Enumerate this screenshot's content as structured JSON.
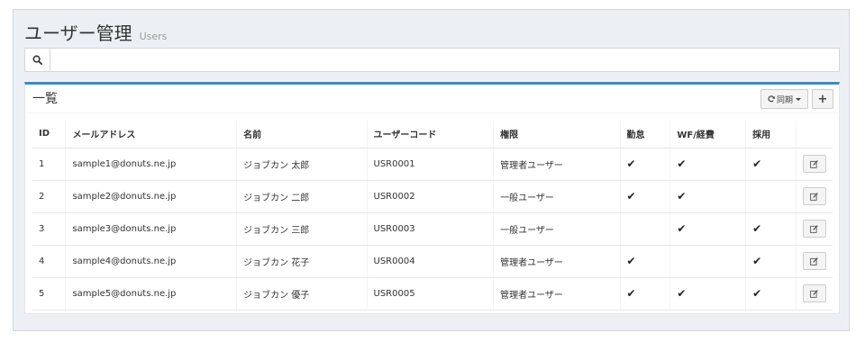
{
  "header": {
    "title": "ユーザー管理",
    "subtitle": "Users"
  },
  "search": {
    "placeholder": "",
    "value": ""
  },
  "list": {
    "title": "一覧",
    "sync_label": "同期",
    "add_label": "+",
    "columns": [
      "ID",
      "メールアドレス",
      "名前",
      "ユーザーコード",
      "権限",
      "勤怠",
      "WF/経費",
      "採用",
      ""
    ],
    "rows": [
      {
        "id": "1",
        "email": "sample1@donuts.ne.jp",
        "name": "ジョブカン 太郎",
        "code": "USR0001",
        "role": "管理者ユーザー",
        "kintai": "✔",
        "wf": "✔",
        "saiyo": "✔"
      },
      {
        "id": "2",
        "email": "sample2@donuts.ne.jp",
        "name": "ジョブカン 二郎",
        "code": "USR0002",
        "role": "一般ユーザー",
        "kintai": "✔",
        "wf": "✔",
        "saiyo": ""
      },
      {
        "id": "3",
        "email": "sample3@donuts.ne.jp",
        "name": "ジョブカン 三郎",
        "code": "USR0003",
        "role": "一般ユーザー",
        "kintai": "",
        "wf": "✔",
        "saiyo": "✔"
      },
      {
        "id": "4",
        "email": "sample4@donuts.ne.jp",
        "name": "ジョブカン 花子",
        "code": "USR0004",
        "role": "管理者ユーザー",
        "kintai": "✔",
        "wf": "",
        "saiyo": "✔"
      },
      {
        "id": "5",
        "email": "sample5@donuts.ne.jp",
        "name": "ジョブカン 優子",
        "code": "USR0005",
        "role": "管理者ユーザー",
        "kintai": "✔",
        "wf": "✔",
        "saiyo": "✔"
      }
    ]
  },
  "icons": {
    "search": "search-icon",
    "sync": "refresh-icon",
    "edit": "edit-icon",
    "check": "check-icon"
  },
  "colors": {
    "accent": "#3c8dbc",
    "background": "#ecf0f5"
  }
}
